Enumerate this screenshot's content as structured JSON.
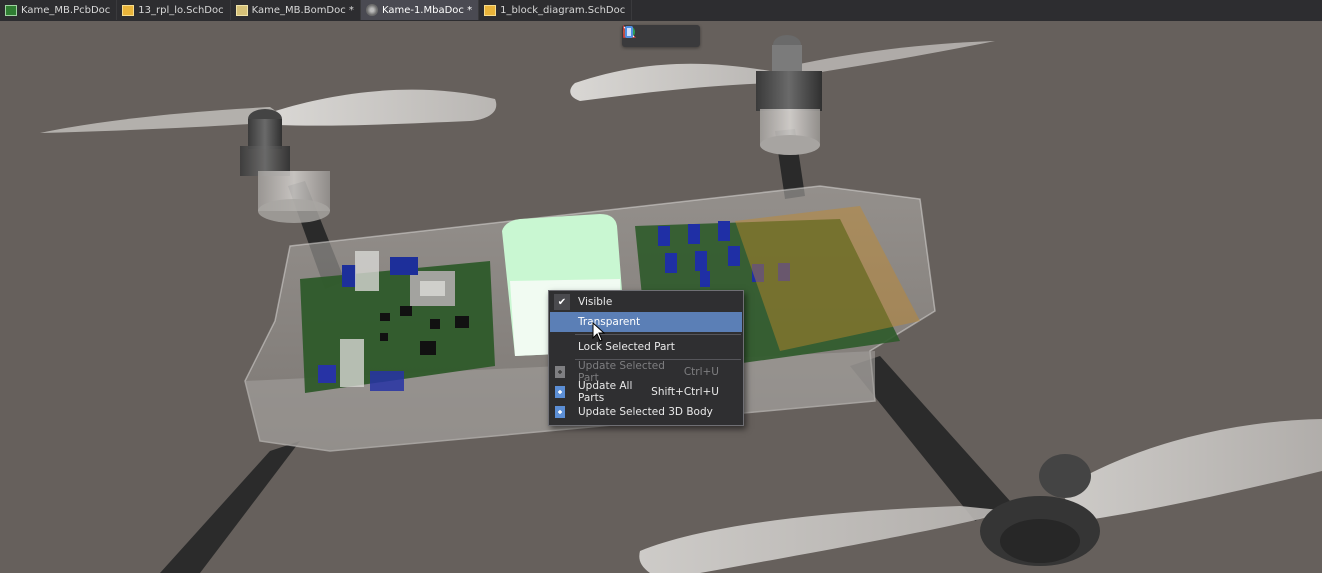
{
  "tabs": [
    {
      "label": "Kame_MB.PcbDoc",
      "icon": "pcb-doc-icon",
      "active": false
    },
    {
      "label": "13_rpl_lo.SchDoc",
      "icon": "sch-doc-icon",
      "active": false
    },
    {
      "label": "Kame_MB.BomDoc *",
      "icon": "bom-doc-icon",
      "active": false
    },
    {
      "label": "Kame-1.MbaDoc *",
      "icon": "mba-doc-icon",
      "active": true
    },
    {
      "label": "1_block_diagram.SchDoc",
      "icon": "sch-doc-icon",
      "active": false
    }
  ],
  "toolbar": {
    "buttons": [
      "explode-icon",
      "section-icon",
      "view-icon"
    ]
  },
  "context_menu": {
    "items": [
      {
        "label": "Visible",
        "checked": true,
        "shortcut": "",
        "enabled": true
      },
      {
        "label": "Transparent",
        "highlighted": true,
        "shortcut": "",
        "enabled": true
      },
      {
        "label": "Lock Selected Part",
        "shortcut": "",
        "enabled": true
      },
      {
        "label": "Update Selected Part",
        "shortcut": "Ctrl+U",
        "enabled": false,
        "icon": "update-part-icon"
      },
      {
        "label": "Update All Parts",
        "shortcut": "Shift+Ctrl+U",
        "enabled": true,
        "icon": "update-all-icon"
      },
      {
        "label": "Update Selected 3D Body",
        "shortcut": "",
        "enabled": true,
        "icon": "update-body-icon"
      }
    ]
  },
  "colors": {
    "viewport_bg": "#66605c",
    "menu_highlight": "#5b7fb6",
    "selected_part": "#c9f7d2",
    "pcb_green": "#2e5a2a"
  }
}
